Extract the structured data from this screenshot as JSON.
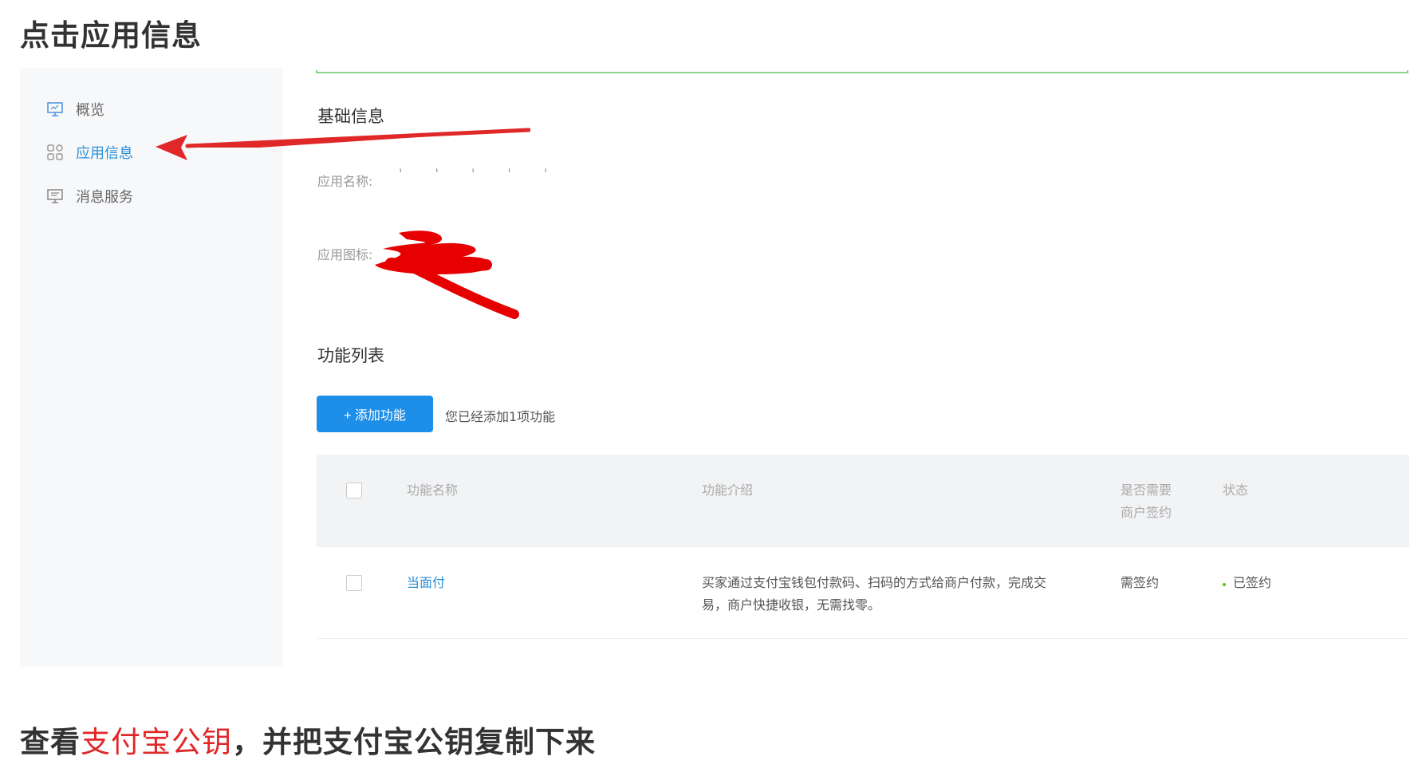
{
  "top_heading": "点击应用信息",
  "sidebar": {
    "items": [
      {
        "label": "概览",
        "icon": "monitor-icon"
      },
      {
        "label": "应用信息",
        "icon": "grid-icon"
      },
      {
        "label": "消息服务",
        "icon": "message-monitor-icon"
      }
    ],
    "active_index": 1
  },
  "basic_info": {
    "title": "基础信息",
    "app_name_label": "应用名称:",
    "app_name_value": "' ' ' ' '",
    "app_icon_label": "应用图标:"
  },
  "features": {
    "title": "功能列表",
    "add_button": "+ 添加功能",
    "added_count_text": "您已经添加1项功能",
    "table": {
      "headers": {
        "name": "功能名称",
        "description": "功能介绍",
        "need_sign_line1": "是否需要",
        "need_sign_line2": "商户签约",
        "status": "状态"
      },
      "rows": [
        {
          "name": "当面付",
          "description_line1": "买家通过支付宝钱包付款码、扫码的方式给商户付款，完成交",
          "description_line2": "易，商户快捷收银，无需找零。",
          "need_sign": "需签约",
          "status": "已签约"
        }
      ]
    }
  },
  "bottom_heading": {
    "part1": "查看",
    "highlight": "支付宝公钥",
    "part2": "，并把支付宝公钥复制下来"
  },
  "colors": {
    "accent_blue": "#1d8fe8",
    "link_blue": "#2a8fd9",
    "annotation_red": "#e02828",
    "success_green": "#52c41a"
  }
}
